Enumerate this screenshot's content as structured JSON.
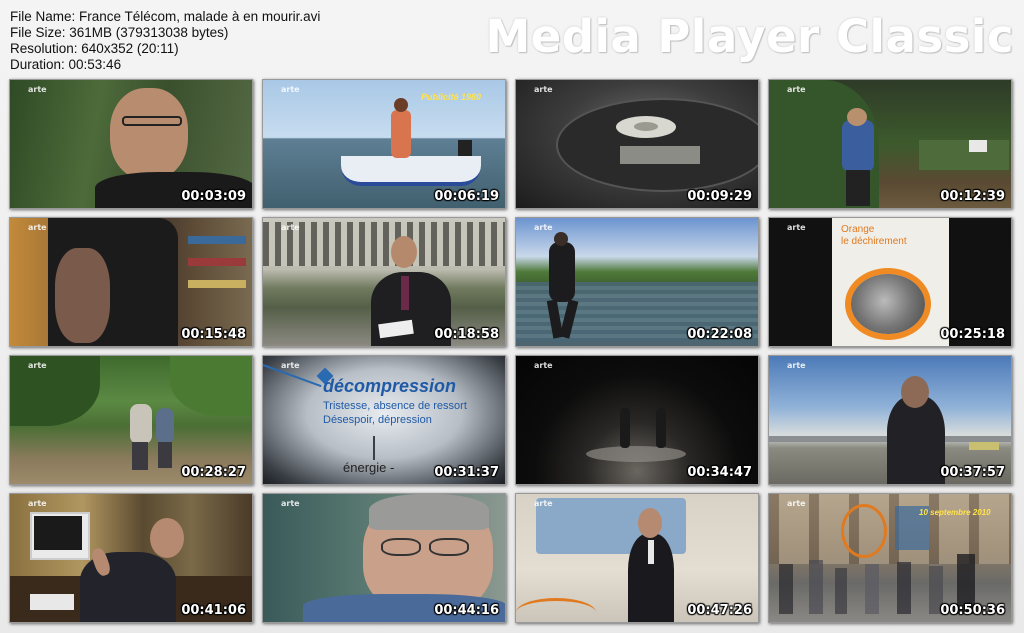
{
  "info": {
    "file_name": "File Name: France Télécom, malade à en mourir.avi",
    "file_size": "File Size: 361MB (379313038 bytes)",
    "resolution": "Resolution: 640x352 (20:11)",
    "duration": "Duration: 00:53:46"
  },
  "brand": "Media Player Classic",
  "channel_logo": "arte",
  "thumbnails": [
    {
      "time": "00:03:09"
    },
    {
      "time": "00:06:19",
      "caption": "Publicité 1980"
    },
    {
      "time": "00:09:29"
    },
    {
      "time": "00:12:39"
    },
    {
      "time": "00:15:48"
    },
    {
      "time": "00:18:58"
    },
    {
      "time": "00:22:08"
    },
    {
      "time": "00:25:18",
      "book_title": "Orange\nle déchirement"
    },
    {
      "time": "00:28:27"
    },
    {
      "time": "00:31:37",
      "heading": "décompression",
      "line1": "Tristesse, absence de ressort",
      "line2": "Désespoir, dépression",
      "footer": "énergie -"
    },
    {
      "time": "00:34:47"
    },
    {
      "time": "00:37:57"
    },
    {
      "time": "00:41:06"
    },
    {
      "time": "00:44:16"
    },
    {
      "time": "00:47:26"
    },
    {
      "time": "00:50:36",
      "caption": "10 septembre 2010"
    }
  ]
}
